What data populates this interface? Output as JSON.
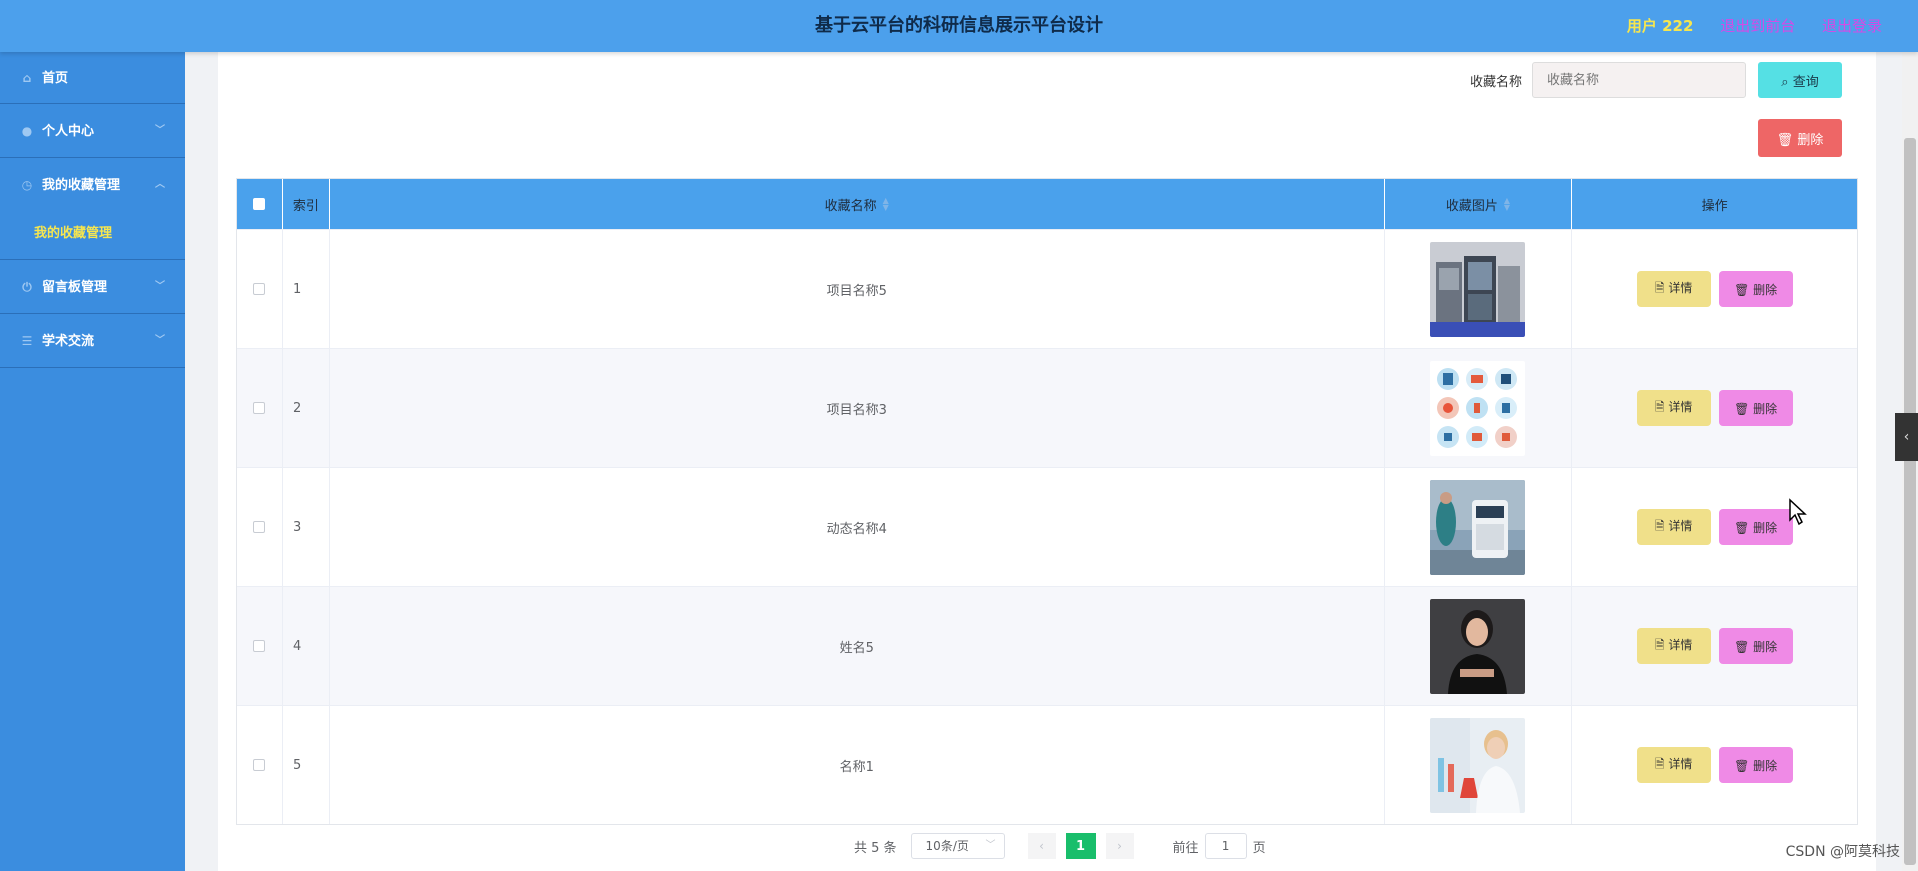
{
  "header": {
    "title": "基于云平台的科研信息展示平台设计",
    "user": "用户 222",
    "back_to_front": "退出到前台",
    "logout": "退出登录"
  },
  "sidebar": {
    "items": [
      {
        "label": "首页",
        "icon": "home-icon"
      },
      {
        "label": "个人中心",
        "icon": "user-icon"
      },
      {
        "label": "我的收藏管理",
        "icon": "clock-icon"
      },
      {
        "label": "留言板管理",
        "icon": "power-icon"
      },
      {
        "label": "学术交流",
        "icon": "sliders-icon"
      }
    ],
    "active_sub": "我的收藏管理"
  },
  "search": {
    "label": "收藏名称",
    "placeholder": "收藏名称",
    "query_button": "查询",
    "delete_button": "删除"
  },
  "table": {
    "headers": {
      "index": "索引",
      "name": "收藏名称",
      "image": "收藏图片",
      "ops": "操作"
    },
    "rows": [
      {
        "index": "1",
        "name": "项目名称5",
        "image": "lab-equipment"
      },
      {
        "index": "2",
        "name": "项目名称3",
        "image": "science-icons"
      },
      {
        "index": "3",
        "name": "动态名称4",
        "image": "hospital-machine"
      },
      {
        "index": "4",
        "name": "姓名5",
        "image": "woman-portrait"
      },
      {
        "index": "5",
        "name": "名称1",
        "image": "scientist-lab"
      }
    ],
    "detail_label": "详情",
    "delete_label": "删除"
  },
  "pagination": {
    "total": "共 5 条",
    "page_size": "10条/页",
    "current_page": "1",
    "goto_label": "前往",
    "goto_value": "1",
    "page_unit": "页"
  },
  "watermark": "CSDN @阿莫科技",
  "colors": {
    "header": "#4ca0ec",
    "sidebar": "#3b8ddf",
    "table_head": "#4aa1ec",
    "query": "#55e0e4",
    "delete_top": "#ee6666",
    "detail": "#f0e08a",
    "delete_row": "#ef8ae6",
    "page_active": "#19be6b"
  }
}
